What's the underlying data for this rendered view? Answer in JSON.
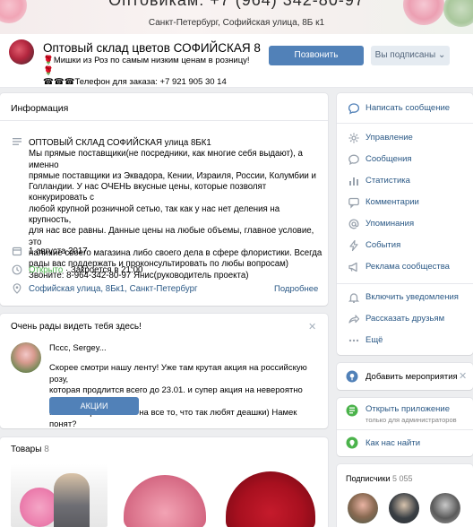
{
  "cover": {
    "phone": "Оптовикам: +7 (964) 342-80-97",
    "address": "Санкт-Петербург, Софийская улица, 8Б к1"
  },
  "header": {
    "title": "Оптовый склад цветов СОФИЙСКАЯ 8",
    "status_line1": "🌹Мишки из Роз по самым низким ценам в розницу! 🌹",
    "status_line2": "☎☎☎Телефон для заказа: +7 921 905 30 14",
    "call_button": "Позвонить",
    "subscribed_button": "Вы подписаны",
    "subscribed_caret": "⌄"
  },
  "info": {
    "heading": "Информация",
    "description_lines": [
      "ОПТОВЫЙ СКЛАД СОФИЙСКАЯ улица 8БК1",
      "Мы прямые поставщики(не посредники, как многие себя выдают), а именно",
      "прямые поставщики из Эквадора, Кении, Израиля, России, Колумбии и",
      "Голландии. У нас ОЧЕНЬ вкусные цены, которые позволят конкурировать с",
      "любой крупной розничной сетью, так как у нас нет деления на крупность,",
      "для нас все равны. Данные цены на любые объемы, главное условие, это",
      "наличие своего магазина либо своего дела в сфере флористики. Всегда",
      "рады вас поддержать и проконсультировать по любы вопросам)",
      "Звоните: 8-964-342-80-97 Янис(руководитель проекта)"
    ],
    "date": "1 августа 2017",
    "open_status": "Открыто",
    "close_time": "· Закроется в 21:00",
    "address_link": "Софийская улица, 8Бк1, Санкт-Петербург",
    "details_link": "Подробнее"
  },
  "post": {
    "heading": "Очень рады видеть тебя здесь!",
    "author": "Пссс, Sergey...",
    "text_lines": [
      "Скорее смотри нашу ленту! Уже там крутая акция на российскую розу,",
      "которая продлится всего до 23.01. и супер акция на невероятно трендовых",
      "Мишек из роз! То есть на все то, что так любят деашки) Намек понят?"
    ],
    "button": "АКЦИИ",
    "close": "✕"
  },
  "products": {
    "heading": "Товары",
    "count": "8"
  },
  "sidebar": {
    "write_message": "Написать сообщение",
    "menu": [
      "Управление",
      "Сообщения",
      "Статистика",
      "Комментарии",
      "Упоминания",
      "События",
      "Реклама сообщества"
    ],
    "notifications": "Включить уведомления",
    "tell_friends": "Рассказать друзьям",
    "more": "Ещё",
    "add_event": "Добавить мероприятия",
    "app_title": "Открыть приложение",
    "app_subtitle": "только для администраторов",
    "directions": "Как нас найти",
    "subscribers_label": "Подписчики",
    "subscribers_count": "5 055"
  },
  "colors": {
    "accent": "#5181b8",
    "link": "#2a5885",
    "open_green": "#4bb34b",
    "background": "#edeef0"
  }
}
